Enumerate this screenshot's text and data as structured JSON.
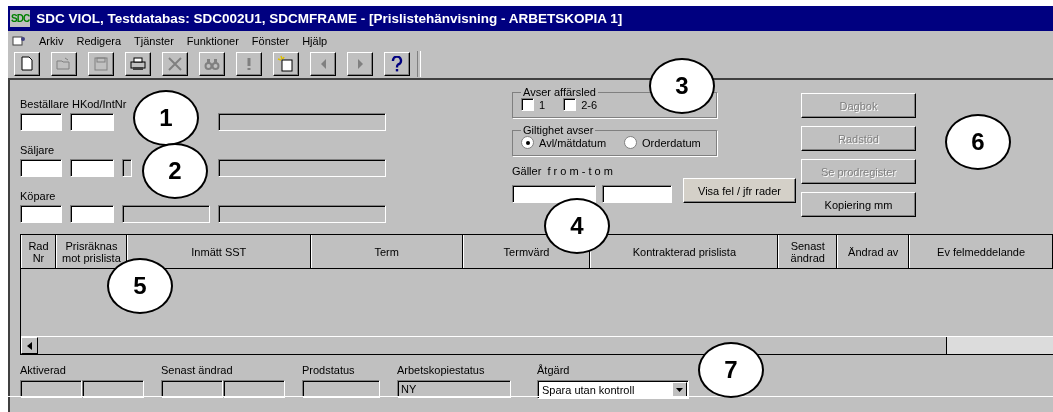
{
  "window": {
    "title": "SDC VIOL, Testdatabas: SDC002U1, SDCMFRAME - [Prislistehänvisning - ARBETSKOPIA 1]",
    "logo": "SDC"
  },
  "menu": [
    "Arkiv",
    "Redigera",
    "Tjänster",
    "Funktioner",
    "Fönster",
    "Hjälp"
  ],
  "toolbar": [
    {
      "kind": "new",
      "disabled": false
    },
    {
      "kind": "open",
      "disabled": true
    },
    {
      "kind": "save",
      "disabled": true
    },
    {
      "kind": "print",
      "disabled": false
    },
    {
      "kind": "delete",
      "disabled": true
    },
    {
      "kind": "find",
      "disabled": true
    },
    {
      "kind": "alert",
      "disabled": true
    },
    {
      "kind": "paste",
      "disabled": false
    },
    {
      "kind": "prev",
      "disabled": true
    },
    {
      "kind": "next",
      "disabled": true
    },
    {
      "kind": "help",
      "disabled": false
    }
  ],
  "parties": [
    {
      "label": "Beställare HKod/IntNr",
      "fields": [
        {
          "readonly": false
        },
        {
          "readonly": false
        },
        {
          "readonly": true
        }
      ]
    },
    {
      "label": "Säljare",
      "fields": [
        {
          "readonly": false
        },
        {
          "readonly": false
        },
        {
          "readonly": true
        },
        {
          "readonly": true
        }
      ]
    },
    {
      "label": "Köpare",
      "fields": [
        {
          "readonly": false
        },
        {
          "readonly": false
        },
        {
          "readonly": true
        },
        {
          "readonly": true
        }
      ]
    }
  ],
  "business_level": {
    "title": "Avser affärsled",
    "options": [
      {
        "label": "1",
        "checked": false
      },
      {
        "label": "2-6",
        "checked": false
      }
    ]
  },
  "validity": {
    "title": "Giltighet avser",
    "options": [
      {
        "label": "Avl/mätdatum",
        "selected": true
      },
      {
        "label": "Orderdatum",
        "selected": false
      }
    ]
  },
  "period": {
    "label": "Gäller  f r o m - t o m",
    "fields": [
      {
        "readonly": false
      },
      {
        "readonly": false
      }
    ]
  },
  "compare_button": {
    "label": "Visa fel / jfr rader"
  },
  "side_buttons": [
    {
      "label": "Dagbok",
      "disabled": true
    },
    {
      "label": "Radstöd",
      "disabled": true
    },
    {
      "label": "Se prodregister",
      "disabled": true
    },
    {
      "label": "Kopiering mm",
      "disabled": false
    }
  ],
  "table": {
    "columns": [
      "Rad Nr",
      "Prisräknas mot prislista",
      "Inmätt SST",
      "Term",
      "Termvärd",
      "Kontrakterad prislista",
      "Senast ändrad",
      "Ändrad av",
      "Ev felmeddelande"
    ]
  },
  "status_fields": [
    {
      "label": "Aktiverad",
      "fields": [
        {
          "readonly": true
        },
        {
          "readonly": true
        }
      ]
    },
    {
      "label": "Senast ändrad",
      "fields": [
        {
          "readonly": true
        },
        {
          "readonly": true
        }
      ]
    },
    {
      "label": "Prodstatus",
      "fields": [
        {
          "readonly": true
        }
      ]
    },
    {
      "label": "Arbetskopiestatus",
      "fields": [
        {
          "value": "NY",
          "readonly": true
        }
      ]
    }
  ],
  "action": {
    "label": "Åtgärd",
    "value": "Spara utan kontroll"
  },
  "callouts": [
    "1",
    "2",
    "3",
    "4",
    "5",
    "6",
    "7"
  ]
}
